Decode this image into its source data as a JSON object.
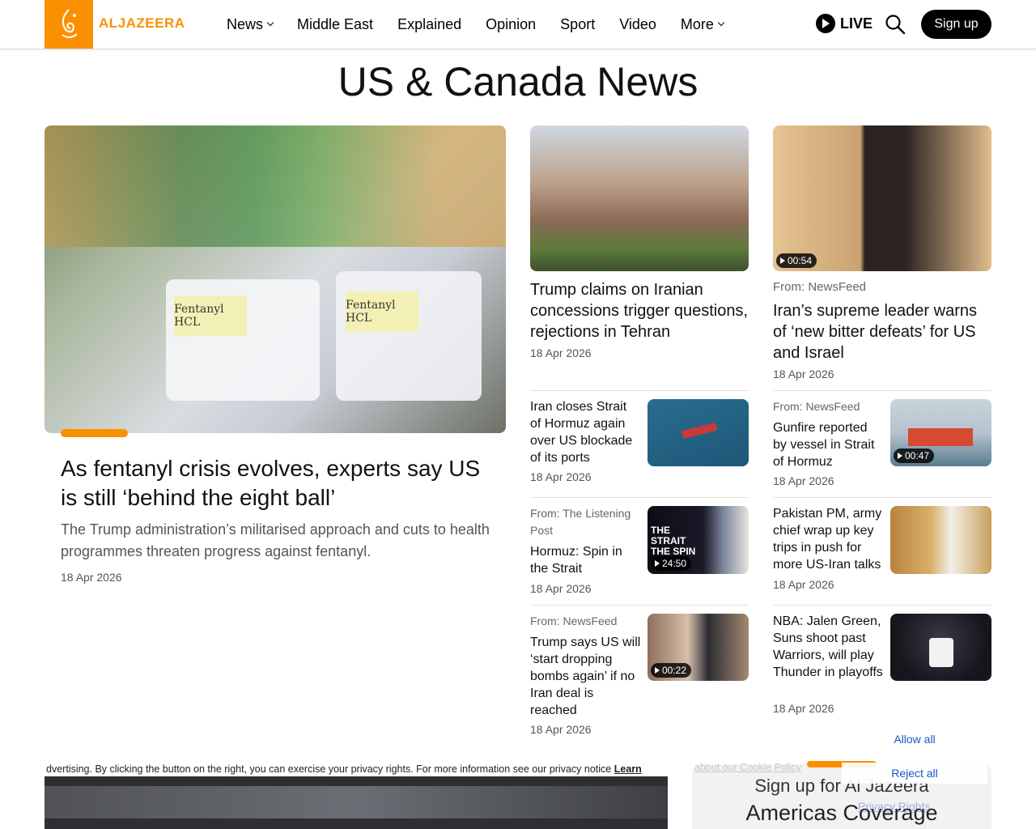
{
  "header": {
    "logo_text": "ALJAZEERA",
    "nav": [
      {
        "label": "News",
        "dropdown": true
      },
      {
        "label": "Middle East",
        "dropdown": false
      },
      {
        "label": "Explained",
        "dropdown": false
      },
      {
        "label": "Opinion",
        "dropdown": false
      },
      {
        "label": "Sport",
        "dropdown": false
      },
      {
        "label": "Video",
        "dropdown": false
      },
      {
        "label": "More",
        "dropdown": true
      }
    ],
    "live_label": "LIVE",
    "signup_label": "Sign up"
  },
  "page_title": "US & Canada News",
  "feature": {
    "title": "As fentanyl crisis evolves, experts say US is still ‘behind the eight ball’",
    "summary": "The Trump administration’s militarised approach and cuts to health programmes threaten progress against fentanyl.",
    "date": "18 Apr 2026",
    "image_tag_1": "Fentanyl HCL",
    "image_tag_2": "Fentanyl HCL"
  },
  "col2_top": {
    "title": "Trump claims on Iranian concessions trigger questions, rejections in Tehran",
    "date": "18 Apr 2026"
  },
  "col3_top": {
    "from": "From: NewsFeed",
    "title": "Iran’s supreme leader warns of ‘new bitter defeats’ for US and Israel",
    "date": "18 Apr 2026",
    "duration": "00:54"
  },
  "col2_items": [
    {
      "from": "",
      "title": "Iran closes Strait of Hormuz again over US blockade of its ports",
      "date": "18 Apr 2026",
      "duration": ""
    },
    {
      "from": "From: The Listening Post",
      "title": "Hormuz: Spin in the Strait",
      "date": "18 Apr 2026",
      "duration": "24:50",
      "thumb_text": "THE STRAIT THE SPIN"
    },
    {
      "from": "From: NewsFeed",
      "title": "Trump says US will ‘start dropping bombs again’ if no Iran deal is reached",
      "date": "18 Apr 2026",
      "duration": "00:22"
    }
  ],
  "col3_items": [
    {
      "from": "From: NewsFeed",
      "title": "Gunfire reported by vessel in Strait of Hormuz",
      "date": "18 Apr 2026",
      "duration": "00:47"
    },
    {
      "from": "",
      "title": "Pakistan PM, army chief wrap up key trips in push for more US-Iran talks",
      "date": "18 Apr 2026",
      "duration": ""
    },
    {
      "from": "",
      "title": "NBA: Jalen Green, Suns shoot past Warriors, will play Thunder in playoffs",
      "date": "18 Apr 2026",
      "duration": ""
    }
  ],
  "consent": {
    "text": "dvertising. By clicking the button on the right, you can exercise your privacy rights. For more information see our privacy notice",
    "learn_label": "Learn",
    "cookie_policy_link": "about our Cookie Policy",
    "allow_all": "Allow all",
    "reject_all": "Reject all",
    "privacy_rights": "Privacy Rights"
  },
  "newsletter": {
    "line1": "Sign up for Al Jazeera",
    "line2": "Americas Coverage"
  },
  "colors": {
    "brand": "#fa9000"
  }
}
